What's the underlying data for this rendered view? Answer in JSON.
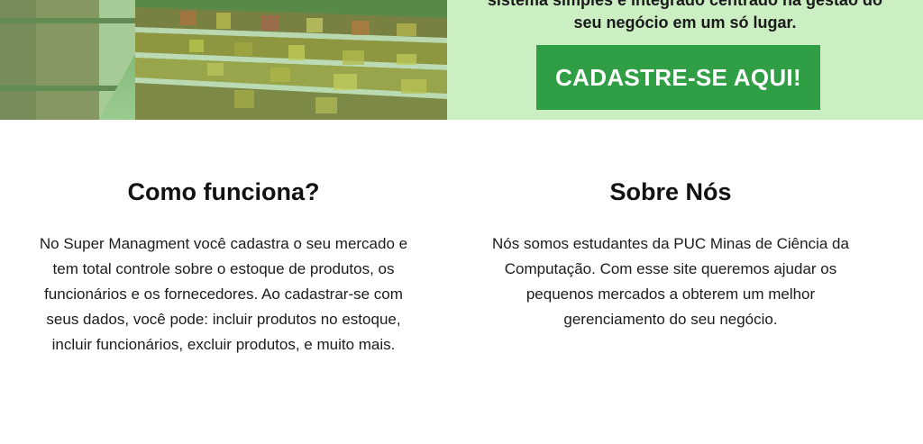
{
  "hero": {
    "tagline_line1": "sistema simples e integrado centrado na gestão do",
    "tagline_line2": "seu negócio em um só lugar.",
    "cta_label": "CADASTRE-SE AQUI!",
    "image_icon": "supermarket-shelves-image"
  },
  "how_it_works": {
    "title": "Como funciona?",
    "body": "No Super Managment você cadastra o seu mercado e tem total controle sobre o estoque de produtos, os funcionários e os fornecedores. Ao cadastrar-se com seus dados, você pode: incluir produtos no estoque, incluir funcionários, excluir produtos, e muito mais."
  },
  "about": {
    "title": "Sobre Nós",
    "body": "Nós somos estudantes da PUC Minas de Ciência da Computação. Com esse site queremos ajudar os pequenos mercados a obterem um melhor gerenciamento do seu negócio."
  },
  "colors": {
    "cta_background": "#2f9e44",
    "hero_panel": "#cbeec2",
    "image_tint": "#4caf50"
  }
}
